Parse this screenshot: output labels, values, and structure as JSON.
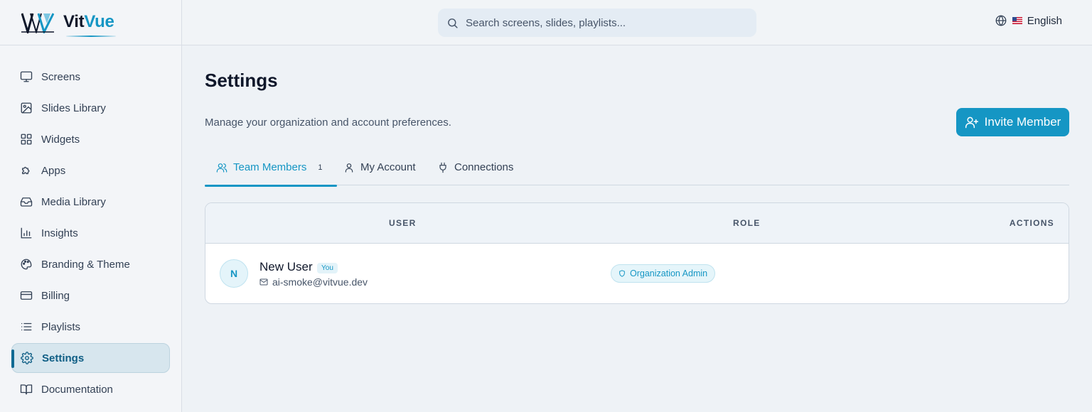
{
  "brand": {
    "name_part1": "Vit",
    "name_part2": "Vue"
  },
  "sidebar": {
    "items": [
      {
        "label": "Screens",
        "icon": "monitor-icon"
      },
      {
        "label": "Slides Library",
        "icon": "image-icon"
      },
      {
        "label": "Widgets",
        "icon": "grid-icon"
      },
      {
        "label": "Apps",
        "icon": "puzzle-icon"
      },
      {
        "label": "Media Library",
        "icon": "inbox-icon"
      },
      {
        "label": "Insights",
        "icon": "bar-chart-icon"
      },
      {
        "label": "Branding & Theme",
        "icon": "palette-icon"
      },
      {
        "label": "Billing",
        "icon": "credit-card-icon"
      },
      {
        "label": "Playlists",
        "icon": "list-icon"
      },
      {
        "label": "Settings",
        "icon": "gear-icon",
        "active": true
      },
      {
        "label": "Documentation",
        "icon": "book-icon"
      }
    ]
  },
  "search": {
    "placeholder": "Search screens, slides, playlists..."
  },
  "language": {
    "label": "English",
    "flag": "us-flag-icon"
  },
  "page": {
    "title": "Settings",
    "subtitle": "Manage your organization and account preferences.",
    "invite_label": "Invite Member"
  },
  "tabs": [
    {
      "label": "Team Members",
      "count": "1",
      "active": true
    },
    {
      "label": "My Account"
    },
    {
      "label": "Connections"
    }
  ],
  "table": {
    "headers": {
      "user": "USER",
      "role": "ROLE",
      "actions": "ACTIONS"
    },
    "rows": [
      {
        "avatar_initial": "N",
        "name": "New User",
        "badge": "You",
        "email": "ai-smoke@vitvue.dev",
        "role": "Organization Admin"
      }
    ]
  },
  "colors": {
    "accent": "#1596c4",
    "active_nav_bg": "#d7e6ee",
    "text": "#0f172a"
  }
}
